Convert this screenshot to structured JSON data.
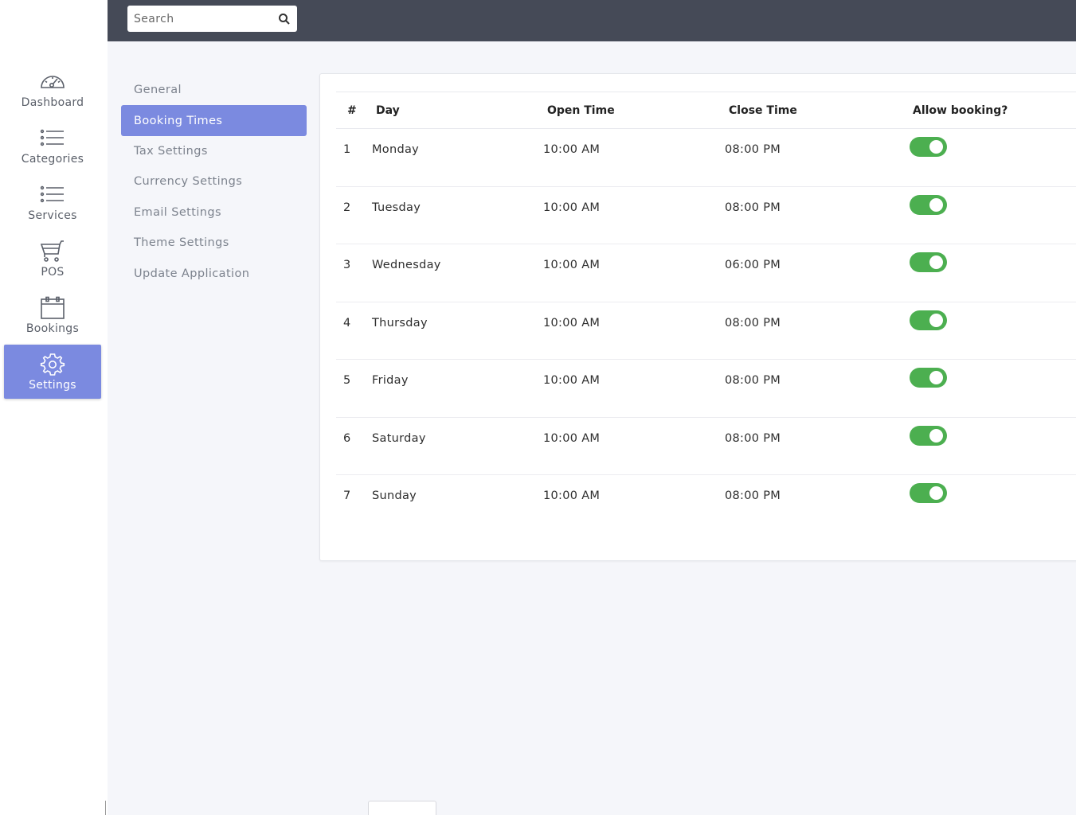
{
  "search": {
    "placeholder": "Search"
  },
  "sidebar": {
    "items": [
      {
        "label": "Dashboard",
        "icon": "dashboard-gauge-icon"
      },
      {
        "label": "Categories",
        "icon": "list-icon"
      },
      {
        "label": "Services",
        "icon": "list-icon"
      },
      {
        "label": "POS",
        "icon": "cart-icon"
      },
      {
        "label": "Bookings",
        "icon": "calendar-icon"
      },
      {
        "label": "Settings",
        "icon": "gear-icon",
        "active": true
      }
    ]
  },
  "submenu": {
    "items": [
      {
        "label": "General"
      },
      {
        "label": "Booking Times",
        "active": true
      },
      {
        "label": "Tax Settings"
      },
      {
        "label": "Currency Settings"
      },
      {
        "label": "Email Settings"
      },
      {
        "label": "Theme Settings"
      },
      {
        "label": "Update Application"
      }
    ]
  },
  "table": {
    "headers": {
      "num": "#",
      "day": "Day",
      "open": "Open Time",
      "close": "Close Time",
      "allow": "Allow booking?"
    },
    "rows": [
      {
        "num": "1",
        "day": "Monday",
        "open": "10:00 AM",
        "close": "08:00 PM",
        "allow": true
      },
      {
        "num": "2",
        "day": "Tuesday",
        "open": "10:00 AM",
        "close": "08:00 PM",
        "allow": true
      },
      {
        "num": "3",
        "day": "Wednesday",
        "open": "10:00 AM",
        "close": "06:00 PM",
        "allow": true
      },
      {
        "num": "4",
        "day": "Thursday",
        "open": "10:00 AM",
        "close": "08:00 PM",
        "allow": true
      },
      {
        "num": "5",
        "day": "Friday",
        "open": "10:00 AM",
        "close": "08:00 PM",
        "allow": true
      },
      {
        "num": "6",
        "day": "Saturday",
        "open": "10:00 AM",
        "close": "08:00 PM",
        "allow": true
      },
      {
        "num": "7",
        "day": "Sunday",
        "open": "10:00 AM",
        "close": "08:00 PM",
        "allow": true
      }
    ]
  },
  "colors": {
    "accent": "#7b8ae0",
    "topbar": "#454a57",
    "toggle_on": "#4caf50"
  }
}
